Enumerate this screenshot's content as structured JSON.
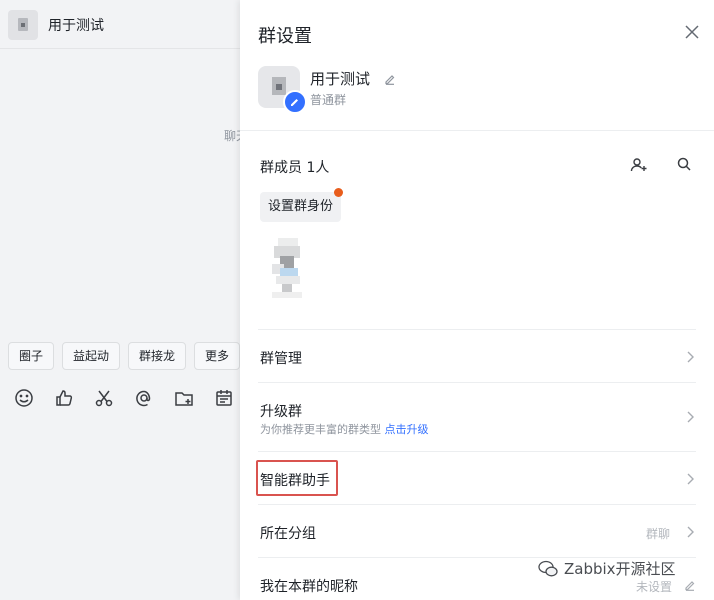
{
  "chat": {
    "title": "用于测试",
    "hint_fragment": "聊天",
    "quick_actions": [
      "圈子",
      "益起动",
      "群接龙",
      "更多"
    ],
    "toolbar_icons": [
      "emoji-icon",
      "thumbs-up-icon",
      "scissors-icon",
      "at-sign-icon",
      "folder-add-icon",
      "calendar-icon"
    ]
  },
  "panel": {
    "title": "群设置",
    "group": {
      "name": "用于测试",
      "type": "普通群"
    },
    "members": {
      "title": "群成员 1人",
      "role_button": "设置群身份"
    },
    "rows": {
      "manage": {
        "label": "群管理"
      },
      "upgrade": {
        "label": "升级群",
        "sub": "为你推荐更丰富的群类型",
        "link": "点击升级"
      },
      "assistant": {
        "label": "智能群助手"
      },
      "category": {
        "label": "所在分组",
        "value": "群聊"
      },
      "nickname": {
        "label": "我在本群的昵称",
        "value": "未设置"
      }
    }
  },
  "watermark": {
    "text": "Zabbix开源社区"
  },
  "colors": {
    "accent": "#3370ff",
    "badge": "#e85d1c",
    "highlight": "#d9534f"
  }
}
